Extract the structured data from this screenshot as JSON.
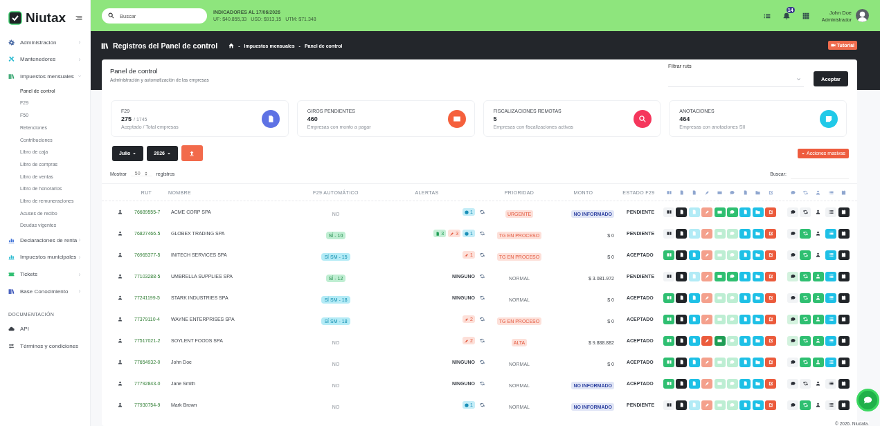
{
  "sidebar": {
    "logo": "Niutax",
    "items": [
      {
        "label": "Administración",
        "kind": "group",
        "expanded": false
      },
      {
        "label": "Mantenedores",
        "kind": "group",
        "expanded": false
      },
      {
        "label": "Impuestos mensuales",
        "kind": "group",
        "expanded": true,
        "children": [
          {
            "label": "Panel de control",
            "selected": true
          },
          {
            "label": "F29",
            "selected": false
          },
          {
            "label": "F50",
            "selected": false
          },
          {
            "label": "Retenciones",
            "selected": false
          },
          {
            "label": "Contribuciones",
            "selected": false
          },
          {
            "label": "Libro de caja",
            "selected": false
          },
          {
            "label": "Libro de compras",
            "selected": false
          },
          {
            "label": "Libro de ventas",
            "selected": false
          },
          {
            "label": "Libro de honorarios",
            "selected": false
          },
          {
            "label": "Libro de remuneraciones",
            "selected": false
          },
          {
            "label": "Acuses de recibo",
            "selected": false
          },
          {
            "label": "Deudas vigentes",
            "selected": false
          }
        ]
      },
      {
        "label": "Declaraciones de renta",
        "kind": "group",
        "expanded": false
      },
      {
        "label": "Impuestos municipales",
        "kind": "group",
        "expanded": false
      },
      {
        "label": "Tickets",
        "kind": "group",
        "expanded": false
      },
      {
        "label": "Base Conocimiento",
        "kind": "group",
        "expanded": false
      }
    ],
    "section_title": "DOCUMENTACIÓN",
    "doc_items": [
      {
        "label": "API"
      },
      {
        "label": "Términos y condiciones"
      }
    ]
  },
  "topbar": {
    "search": {
      "placeholder": "Buscar"
    },
    "indicators": {
      "title": "INDICADORES AL 17/06/2026",
      "values": [
        "UF: $40.855,33",
        "USD: $913,15",
        "UTM: $71.348"
      ]
    },
    "notifications": "14",
    "user": {
      "name": "John Doe",
      "role": "Administrador"
    }
  },
  "page_header": {
    "title": "Registros del Panel de control",
    "separator": "-",
    "breadcrumb": [
      "Impuestos mensuales",
      "Panel de control"
    ],
    "tutorial": "Tutorial"
  },
  "panel": {
    "title": "Panel de control",
    "subtitle": "Administración y automatización de las empresas",
    "filter_label": "Filtrar ruts",
    "accept": "Aceptar"
  },
  "stats": [
    {
      "title": "F29",
      "value": "275",
      "total": "/ 1745",
      "caption": "Aceptado / Total empresas",
      "color": "#5e72e4"
    },
    {
      "title": "GIROS PENDIENTES",
      "value": "460",
      "caption": "Empresas con monto a pagar",
      "color": "#f5603c"
    },
    {
      "title": "FISCALIZACIONES REMOTAS",
      "value": "5",
      "caption": "Empresas con fiscalizaciones activas",
      "color": "#f5365c"
    },
    {
      "title": "ANOTACIONES",
      "value": "464",
      "caption": "Empresas con anotaciones SII",
      "color": "#20c9e8"
    }
  ],
  "controls": {
    "month": "Julio",
    "year": "2026",
    "bulk": "Acciones masivas",
    "show": "Mostrar",
    "page_size": "50",
    "records": "registros",
    "search_label": "Buscar:"
  },
  "table": {
    "columns": [
      "RUT",
      "NOMBRE",
      "F29 AUTOMÁTICO",
      "ALERTAS",
      "PRIORIDAD",
      "MONTO",
      "ESTADO F29"
    ],
    "rows": [
      {
        "rut": "76689555-7",
        "name": "ACME CORP SPA",
        "f29": {
          "kind": "none",
          "text": "NO"
        },
        "alerts": [
          {
            "kind": "info",
            "count": "1"
          }
        ],
        "priority": {
          "kind": "high",
          "text": "URGENTE"
        },
        "amount": {
          "kind": "missing",
          "text": "NO INFORMADO"
        },
        "status": "PENDIENTE",
        "actions": [
          {
            "color": "#f1f3f5"
          },
          {
            "color": "#212529"
          },
          {
            "color": "#b2ebf6"
          },
          {
            "color": "#f4a08c"
          },
          {
            "color": "#2fbf71"
          },
          {
            "color": "#2fbf71"
          },
          {
            "color": "#1ec0e6"
          },
          {
            "color": "#1ec0e6"
          },
          {
            "color": "#eb5b3c"
          }
        ],
        "tools": [
          {
            "color": "#f1f3f5"
          },
          {
            "color": "#f1f3f5"
          },
          {
            "color": "#ffffff"
          },
          {
            "color": "#f1f3f5"
          },
          {
            "color": "#212529"
          }
        ]
      },
      {
        "rut": "76827466-5",
        "name": "GLOBEX TRADING SPA",
        "f29": {
          "kind": "si",
          "text": "SÍ - 10"
        },
        "alerts": [
          {
            "kind": "doc",
            "count": "3"
          },
          {
            "kind": "edit",
            "count": "3"
          },
          {
            "kind": "info",
            "count": "1"
          }
        ],
        "priority": {
          "kind": "high",
          "text": "TG EN PROCESO"
        },
        "amount": {
          "kind": "amount",
          "text": "$ 0"
        },
        "status": "PENDIENTE",
        "actions": [
          {
            "color": "#f1f3f5"
          },
          {
            "color": "#212529"
          },
          {
            "color": "#b2ebf6"
          },
          {
            "color": "#f4a08c"
          },
          {
            "color": "#bdeed3"
          },
          {
            "color": "#bdeed3"
          },
          {
            "color": "#1ec0e6"
          },
          {
            "color": "#1ec0e6"
          },
          {
            "color": "#eb5b3c"
          }
        ],
        "tools": [
          {
            "color": "#f1f3f5"
          },
          {
            "color": "#2fbf71"
          },
          {
            "color": "#ffffff"
          },
          {
            "color": "#1ec0e6"
          },
          {
            "color": "#212529"
          }
        ]
      },
      {
        "rut": "76965377-5",
        "name": "INITECH SERVICES SPA",
        "f29": {
          "kind": "sim",
          "text": "SÍ SM - 15"
        },
        "alerts": [
          {
            "kind": "edit",
            "count": "1"
          }
        ],
        "priority": {
          "kind": "high",
          "text": "TG EN PROCESO"
        },
        "amount": {
          "kind": "amount",
          "text": "$ 0"
        },
        "status": "ACEPTADO",
        "actions": [
          {
            "color": "#2fbf71"
          },
          {
            "color": "#212529"
          },
          {
            "color": "#1ec0e6"
          },
          {
            "color": "#f4a08c"
          },
          {
            "color": "#bdeed3"
          },
          {
            "color": "#bdeed3"
          },
          {
            "color": "#1ec0e6"
          },
          {
            "color": "#1ec0e6"
          },
          {
            "color": "#eb5b3c"
          }
        ],
        "tools": [
          {
            "color": "#f1f3f5"
          },
          {
            "color": "#2fbf71"
          },
          {
            "color": "#ffffff"
          },
          {
            "color": "#1ec0e6"
          },
          {
            "color": "#212529"
          }
        ]
      },
      {
        "rut": "77103288-5",
        "name": "UMBRELLA SUPPLIES SPA",
        "f29": {
          "kind": "si",
          "text": "SÍ - 12"
        },
        "alerts_empty": "NINGUNO",
        "priority": {
          "kind": "normal",
          "text": "NORMAL"
        },
        "amount": {
          "kind": "amount",
          "text": "$ 3.081.972"
        },
        "status": "PENDIENTE",
        "actions": [
          {
            "color": "#f1f3f5"
          },
          {
            "color": "#212529"
          },
          {
            "color": "#b2ebf6"
          },
          {
            "color": "#f4a08c"
          },
          {
            "color": "#2fbf71"
          },
          {
            "color": "#2fbf71"
          },
          {
            "color": "#1ec0e6"
          },
          {
            "color": "#1ec0e6"
          },
          {
            "color": "#eb5b3c"
          }
        ],
        "tools": [
          {
            "color": "#d3f2de"
          },
          {
            "color": "#2fbf71"
          },
          {
            "color": "#2fbf71"
          },
          {
            "color": "#1ec0e6"
          },
          {
            "color": "#212529"
          }
        ]
      },
      {
        "rut": "77241199-5",
        "name": "STARK INDUSTRIES SPA",
        "f29": {
          "kind": "sim",
          "text": "SÍ SM - 18"
        },
        "alerts_empty": "NINGUNO",
        "priority": {
          "kind": "normal",
          "text": "NORMAL"
        },
        "amount": {
          "kind": "amount",
          "text": "$ 0"
        },
        "status": "ACEPTADO",
        "actions": [
          {
            "color": "#2fbf71"
          },
          {
            "color": "#212529"
          },
          {
            "color": "#1ec0e6"
          },
          {
            "color": "#f4a08c"
          },
          {
            "color": "#bdeed3"
          },
          {
            "color": "#bdeed3"
          },
          {
            "color": "#1ec0e6"
          },
          {
            "color": "#1ec0e6"
          },
          {
            "color": "#eb5b3c"
          }
        ],
        "tools": [
          {
            "color": "#f1f3f5"
          },
          {
            "color": "#2fbf71"
          },
          {
            "color": "#2fbf71"
          },
          {
            "color": "#1ec0e6"
          },
          {
            "color": "#212529"
          }
        ]
      },
      {
        "rut": "77379110-4",
        "name": "WAYNE ENTERPRISES SPA",
        "f29": {
          "kind": "sim",
          "text": "SÍ SM - 18"
        },
        "alerts": [
          {
            "kind": "edit",
            "count": "2"
          }
        ],
        "priority": {
          "kind": "high",
          "text": "TG EN PROCESO"
        },
        "amount": {
          "kind": "amount",
          "text": "$ 0"
        },
        "status": "ACEPTADO",
        "actions": [
          {
            "color": "#2fbf71"
          },
          {
            "color": "#212529"
          },
          {
            "color": "#1ec0e6"
          },
          {
            "color": "#f4a08c"
          },
          {
            "color": "#bdeed3"
          },
          {
            "color": "#bdeed3"
          },
          {
            "color": "#1ec0e6"
          },
          {
            "color": "#1ec0e6"
          },
          {
            "color": "#eb5b3c"
          }
        ],
        "tools": [
          {
            "color": "#d3f2de"
          },
          {
            "color": "#2fbf71"
          },
          {
            "color": "#2fbf71"
          },
          {
            "color": "#1ec0e6"
          },
          {
            "color": "#212529"
          }
        ]
      },
      {
        "rut": "77517021-2",
        "name": "SOYLENT FOODS SPA",
        "f29": {
          "kind": "none",
          "text": "NO"
        },
        "alerts": [
          {
            "kind": "edit",
            "count": "2"
          }
        ],
        "priority": {
          "kind": "high",
          "text": "ALTA"
        },
        "amount": {
          "kind": "amount",
          "text": "$ 9.888.882"
        },
        "status": "ACEPTADO",
        "actions": [
          {
            "color": "#2fbf71"
          },
          {
            "color": "#212529"
          },
          {
            "color": "#1ec0e6"
          },
          {
            "color": "#eb5b3c"
          },
          {
            "color": "#1f9d55"
          },
          {
            "color": "#bdeed3"
          },
          {
            "color": "#1ec0e6"
          },
          {
            "color": "#1ec0e6"
          },
          {
            "color": "#eb5b3c"
          }
        ],
        "tools": [
          {
            "color": "#d3f2de"
          },
          {
            "color": "#2fbf71"
          },
          {
            "color": "#2fbf71"
          },
          {
            "color": "#1ec0e6"
          },
          {
            "color": "#212529"
          }
        ]
      },
      {
        "rut": "77654932-0",
        "name": "John Doe",
        "f29": {
          "kind": "none",
          "text": "NO"
        },
        "alerts_empty": "NINGUNO",
        "priority": {
          "kind": "normal",
          "text": "NORMAL"
        },
        "amount": {
          "kind": "amount",
          "text": "$ 0"
        },
        "status": "ACEPTADO",
        "actions": [
          {
            "color": "#2fbf71"
          },
          {
            "color": "#212529"
          },
          {
            "color": "#1ec0e6"
          },
          {
            "color": "#f4a08c"
          },
          {
            "color": "#bdeed3"
          },
          {
            "color": "#bdeed3"
          },
          {
            "color": "#1ec0e6"
          },
          {
            "color": "#1ec0e6"
          },
          {
            "color": "#eb5b3c"
          }
        ],
        "tools": [
          {
            "color": "#f1f3f5"
          },
          {
            "color": "#2fbf71"
          },
          {
            "color": "#2fbf71"
          },
          {
            "color": "#1ec0e6"
          },
          {
            "color": "#212529"
          }
        ]
      },
      {
        "rut": "77792843-0",
        "name": "Jane Smith",
        "f29": {
          "kind": "none",
          "text": "NO"
        },
        "alerts_empty": "NINGUNO",
        "priority": {
          "kind": "normal",
          "text": "NORMAL"
        },
        "amount": {
          "kind": "missing",
          "text": "NO INFORMADO"
        },
        "status": "ACEPTADO",
        "actions": [
          {
            "color": "#2fbf71"
          },
          {
            "color": "#212529"
          },
          {
            "color": "#1ec0e6"
          },
          {
            "color": "#f4a08c"
          },
          {
            "color": "#bdeed3"
          },
          {
            "color": "#bdeed3"
          },
          {
            "color": "#1ec0e6"
          },
          {
            "color": "#1ec0e6"
          },
          {
            "color": "#eb5b3c"
          }
        ],
        "tools": [
          {
            "color": "#f1f3f5"
          },
          {
            "color": "#f1f3f5"
          },
          {
            "color": "#ffffff"
          },
          {
            "color": "#f1f3f5"
          },
          {
            "color": "#212529"
          }
        ]
      },
      {
        "rut": "77930754-9",
        "name": "Mark Brown",
        "f29": {
          "kind": "none",
          "text": "NO"
        },
        "alerts": [
          {
            "kind": "info",
            "count": "1"
          }
        ],
        "priority": {
          "kind": "normal",
          "text": "NORMAL"
        },
        "amount": {
          "kind": "missing",
          "text": "NO INFORMADO"
        },
        "status": "PENDIENTE",
        "actions": [
          {
            "color": "#f1f3f5"
          },
          {
            "color": "#212529"
          },
          {
            "color": "#b2ebf6"
          },
          {
            "color": "#f4a08c"
          },
          {
            "color": "#bdeed3"
          },
          {
            "color": "#bdeed3"
          },
          {
            "color": "#1ec0e6"
          },
          {
            "color": "#1ec0e6"
          },
          {
            "color": "#eb5b3c"
          }
        ],
        "tools": [
          {
            "color": "#f1f3f5"
          },
          {
            "color": "#2fbf71"
          },
          {
            "color": "#ffffff"
          },
          {
            "color": "#f1f3f5"
          },
          {
            "color": "#212529"
          }
        ]
      }
    ]
  },
  "footer": "© 2026. Niudata."
}
